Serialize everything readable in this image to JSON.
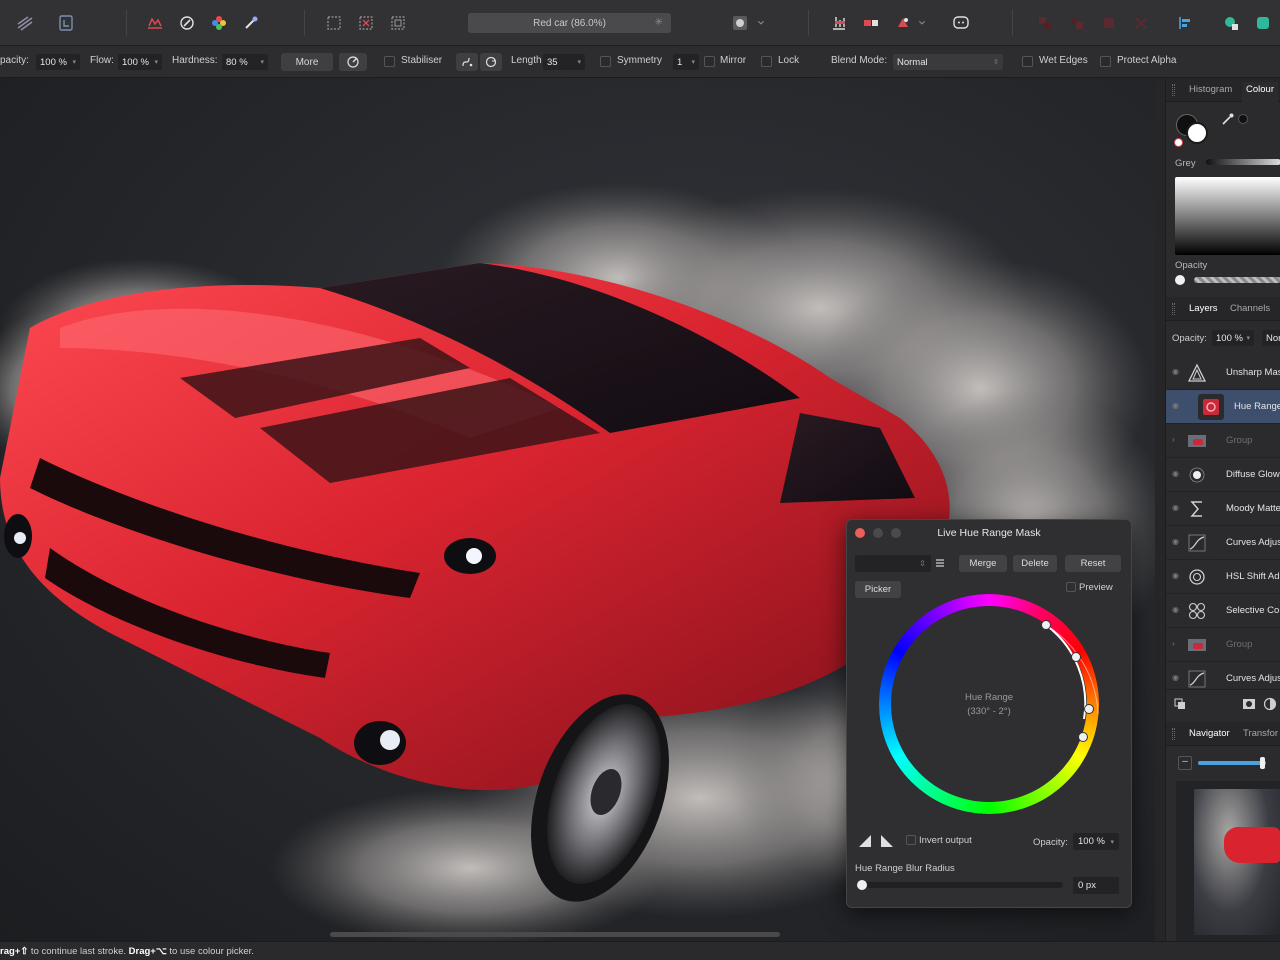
{
  "app": {
    "document_title": "Red car (86.0%)"
  },
  "toolbar": {
    "icons": [
      "persona-photo-icon",
      "persona-liquify-icon",
      "brush-tool-icon",
      "dodge-icon",
      "colour-wheel-icon",
      "eyedropper-icon",
      "selection-rect-icon",
      "selection-cross-icon",
      "selection-marquee-icon",
      "quick-mask-icon",
      "align-icon",
      "snapping-icon",
      "assistant-icon",
      "arrange-icon",
      "studio-icon",
      "view-icon"
    ]
  },
  "context_bar": {
    "opacity_label": "pacity:",
    "opacity_value": "100 %",
    "flow_label": "Flow:",
    "flow_value": "100 %",
    "hardness_label": "Hardness:",
    "hardness_value": "80 %",
    "more_button": "More",
    "stabiliser_label": "Stabiliser",
    "length_label": "Length",
    "length_value": "35",
    "symmetry_label": "Symmetry",
    "symmetry_value": "1",
    "mirror_label": "Mirror",
    "lock_label": "Lock",
    "blend_mode_label": "Blend Mode:",
    "blend_mode_value": "Normal",
    "wet_edges_label": "Wet Edges",
    "protect_alpha_label": "Protect Alpha"
  },
  "colour_panel": {
    "tabs": [
      "Histogram",
      "Colour"
    ],
    "active_tab": "Colour",
    "mode_label": "Grey",
    "opacity_label": "Opacity"
  },
  "layers_panel": {
    "tabs": [
      "Layers",
      "Channels"
    ],
    "active_tab": "Layers",
    "opacity_label": "Opacity:",
    "opacity_value": "100 %",
    "blend_value": "Nor",
    "layers": [
      {
        "name": "Unsharp Mas",
        "icon": "unsharp-mask-icon",
        "dim": false,
        "selected": false
      },
      {
        "name": "Hue Range",
        "icon": "hue-range-mask-icon",
        "dim": false,
        "selected": true
      },
      {
        "name": "Group",
        "icon": "group-thumbnail",
        "dim": true,
        "selected": false
      },
      {
        "name": "Diffuse Glow",
        "icon": "diffuse-glow-icon",
        "dim": false,
        "selected": false
      },
      {
        "name": "Moody Matte",
        "icon": "sigma-icon",
        "dim": false,
        "selected": false
      },
      {
        "name": "Curves Adjus",
        "icon": "curves-icon",
        "dim": false,
        "selected": false
      },
      {
        "name": "HSL Shift Ad",
        "icon": "hsl-icon",
        "dim": false,
        "selected": false
      },
      {
        "name": "Selective Co",
        "icon": "selective-colour-icon",
        "dim": false,
        "selected": false
      },
      {
        "name": "Group",
        "icon": "group-thumbnail",
        "dim": true,
        "selected": false
      },
      {
        "name": "Curves Adjus",
        "icon": "curves-icon",
        "dim": false,
        "selected": false
      }
    ]
  },
  "navigator_panel": {
    "tabs": [
      "Navigator",
      "Transfor"
    ],
    "active_tab": "Navigator"
  },
  "hue_dialog": {
    "title": "Live Hue Range Mask",
    "merge_button": "Merge",
    "delete_button": "Delete",
    "reset_button": "Reset",
    "picker_button": "Picker",
    "preview_label": "Preview",
    "wheel_label_line1": "Hue Range",
    "wheel_label_line2": "(330° - 2°)",
    "invert_output_label": "Invert output",
    "opacity_label": "Opacity:",
    "opacity_value": "100 %",
    "blur_label": "Hue Range Blur Radius",
    "blur_value": "0 px",
    "blur_fraction": 0
  },
  "status_bar": {
    "key1": "rag+⇧",
    "text1": " to continue last stroke. ",
    "key2": "Drag+⌥",
    "text2": " to use colour picker."
  },
  "colors": {
    "accent_blue": "#3d4f6c",
    "car_red": "#d92430",
    "close_red": "#ec5f5a"
  }
}
